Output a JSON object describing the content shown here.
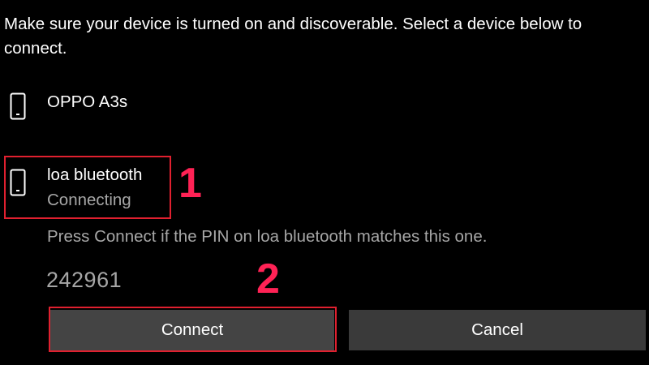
{
  "instructions": "Make sure your device is turned on and discoverable. Select a device below to connect.",
  "devices": [
    {
      "name": "OPPO A3s",
      "status": "",
      "icon": "phone-icon"
    },
    {
      "name": "loa bluetooth",
      "status": "Connecting",
      "icon": "phone-icon"
    }
  ],
  "pairing": {
    "prompt": "Press Connect if the PIN on loa bluetooth matches this one.",
    "pin": "242961"
  },
  "buttons": {
    "connect_label": "Connect",
    "cancel_label": "Cancel"
  },
  "annotations": {
    "step1": "1",
    "step2": "2"
  },
  "colors": {
    "background": "#000000",
    "text_primary": "#ffffff",
    "text_secondary": "#a6a6a6",
    "button_bg": "#3a3a3a",
    "highlight_border": "#e0202f",
    "step_label": "#ff2255"
  }
}
